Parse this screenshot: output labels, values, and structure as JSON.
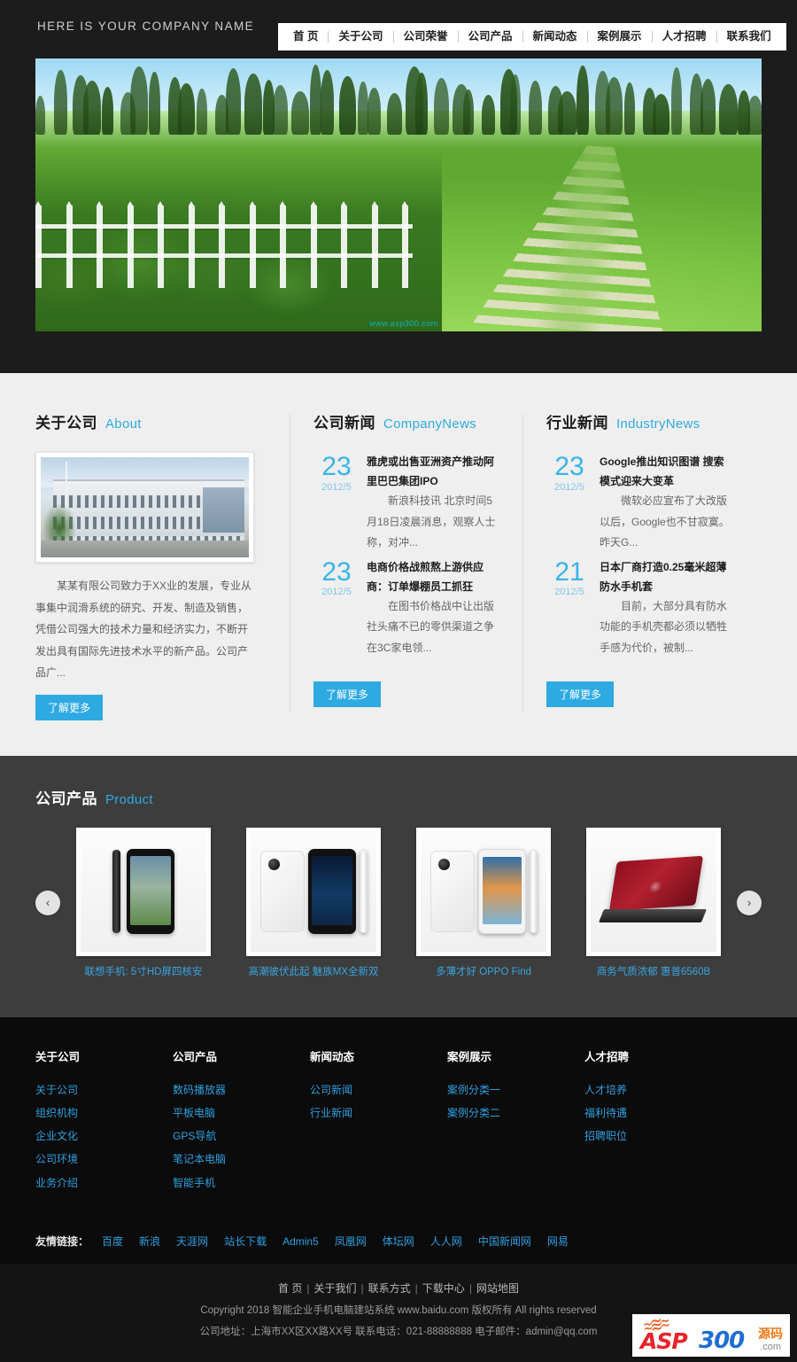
{
  "header": {
    "brand": "HERE IS YOUR COMPANY NAME",
    "nav": [
      {
        "label": "首 页"
      },
      {
        "label": "关于公司"
      },
      {
        "label": "公司荣誉"
      },
      {
        "label": "公司产品"
      },
      {
        "label": "新闻动态"
      },
      {
        "label": "案例展示"
      },
      {
        "label": "人才招聘"
      },
      {
        "label": "联系我们"
      }
    ]
  },
  "hero": {
    "watermark": "www.asp300.com",
    "alt": "绿色草地树林石板小路风景"
  },
  "about": {
    "title_cn": "关于公司",
    "title_en": "About",
    "photo_alt": "公司办公楼外景",
    "text": "某某有限公司致力于XX业的发展，专业从事集中润滑系统的研究、开发、制造及销售，凭借公司强大的技术力量和经济实力，不断开发出具有国际先进技术水平的新产品。公司产品广...",
    "more_label": "了解更多"
  },
  "company_news": {
    "title_cn": "公司新闻",
    "title_en": "CompanyNews",
    "more_label": "了解更多",
    "items": [
      {
        "day": "23",
        "ym": "2012/5",
        "title": "雅虎或出售亚洲资产推动阿里巴巴集团IPO",
        "desc": "新浪科技讯  北京时间5月18日凌晨消息，观察人士称，对冲..."
      },
      {
        "day": "23",
        "ym": "2012/5",
        "title": "电商价格战煎熬上游供应商：订单爆棚员工抓狂",
        "desc": "在图书价格战中让出版社头痛不已的零供渠道之争在3C家电领..."
      }
    ]
  },
  "industry_news": {
    "title_cn": "行业新闻",
    "title_en": "IndustryNews",
    "more_label": "了解更多",
    "items": [
      {
        "day": "23",
        "ym": "2012/5",
        "title": "Google推出知识图谱 搜索模式迎来大变革",
        "desc": "微软必应宣布了大改版以后，Google也不甘寂寞。昨天G..."
      },
      {
        "day": "21",
        "ym": "2012/5",
        "title": "日本厂商打造0.25毫米超薄防水手机套",
        "desc": "目前，大部分具有防水功能的手机壳都必须以牺牲手感为代价，被制..."
      }
    ]
  },
  "products": {
    "title_cn": "公司产品",
    "title_en": "Product",
    "prev_label": "‹",
    "next_label": "›",
    "items": [
      {
        "caption": "联想手机: 5寸HD屏四核安"
      },
      {
        "caption": "高潮彼伏此起 魅族MX全新双"
      },
      {
        "caption": "多薄才好 OPPO Find"
      },
      {
        "caption": "商务气质浓郁 惠普6560B"
      }
    ]
  },
  "footer": {
    "columns": [
      {
        "head": "关于公司",
        "links": [
          "关于公司",
          "组织机构",
          "企业文化",
          "公司环境",
          "业务介绍"
        ]
      },
      {
        "head": "公司产品",
        "links": [
          "数码播放器",
          "平板电脑",
          "GPS导航",
          "笔记本电脑",
          "智能手机"
        ]
      },
      {
        "head": "新闻动态",
        "links": [
          "公司新闻",
          "行业新闻"
        ]
      },
      {
        "head": "案例展示",
        "links": [
          "案例分类一",
          "案例分类二"
        ]
      },
      {
        "head": "人才招聘",
        "links": [
          "人才培养",
          "福利待遇",
          "招聘职位"
        ]
      }
    ],
    "friend_label": "友情链接：",
    "friend_links": [
      "百度",
      "新浪",
      "天涯网",
      "站长下载",
      "Admin5",
      "凤凰网",
      "体坛网",
      "人人网",
      "中国新闻网",
      "网易"
    ]
  },
  "copyright": {
    "nav": [
      "首 页",
      "关于我们",
      "联系方式",
      "下载中心",
      "网站地图"
    ],
    "line1": "Copyright 2018 智能企业手机电脑建站系统 www.baidu.com 版权所有 All rights reserved",
    "line2": "公司地址：上海市XX区XX路XX号 联系电话：021-88888888 电子邮件：admin@qq.com"
  },
  "watermark_logo": {
    "asp": "ASP",
    "num": "300",
    "cn": "源码",
    "com": ".com"
  },
  "colors": {
    "accent": "#2eaae2",
    "header_bg": "#1c1c1c",
    "light_bg": "#efefef",
    "product_bg": "#3d3d3d",
    "footer_bg": "#0b0b0b",
    "link_blue": "#2e9fe0"
  }
}
